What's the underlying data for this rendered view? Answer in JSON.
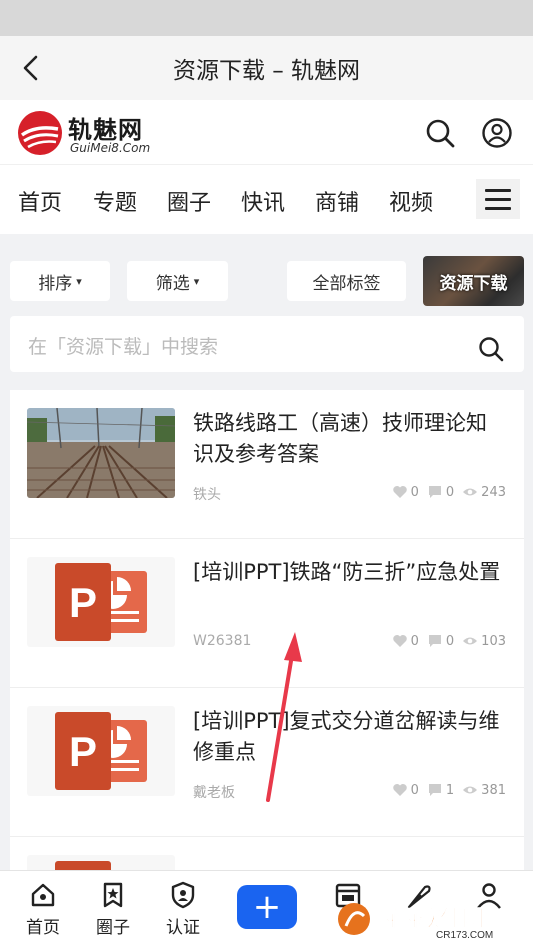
{
  "titlebar": {
    "title": "资源下载 – 轨魅网"
  },
  "header": {
    "logo_name": "轨魅网",
    "logo_sub": "GuiMei8.Com"
  },
  "nav": {
    "items": [
      "首页",
      "专题",
      "圈子",
      "快讯",
      "商铺",
      "视频"
    ]
  },
  "filters": {
    "sort": "排序",
    "filter": "筛选",
    "all_tags": "全部标签",
    "download": "资源下载"
  },
  "search": {
    "placeholder": "在「资源下载」中搜索"
  },
  "items": [
    {
      "title": "铁路线路工（高速）技师理论知识及参考答案",
      "author": "铁头",
      "likes": "0",
      "comments": "0",
      "views": "243",
      "thumb": "railway-photo"
    },
    {
      "title": "[培训PPT]铁路“防三折”应急处置",
      "author": "W26381",
      "likes": "0",
      "comments": "0",
      "views": "103",
      "thumb": "ppt-icon"
    },
    {
      "title": "[培训PPT]复式交分道岔解读与维修重点",
      "author": "戴老板",
      "likes": "0",
      "comments": "1",
      "views": "381",
      "thumb": "ppt-icon"
    }
  ],
  "tabbar": {
    "home": "首页",
    "circle": "圈子",
    "verify": "认证",
    "plus": "+"
  },
  "watermark": {
    "text": "西西软件园",
    "sub": "CR173.COM"
  },
  "colors": {
    "accent": "#1a64f0",
    "logo_red": "#d6202a",
    "ppt_orange": "#c94a2a"
  }
}
